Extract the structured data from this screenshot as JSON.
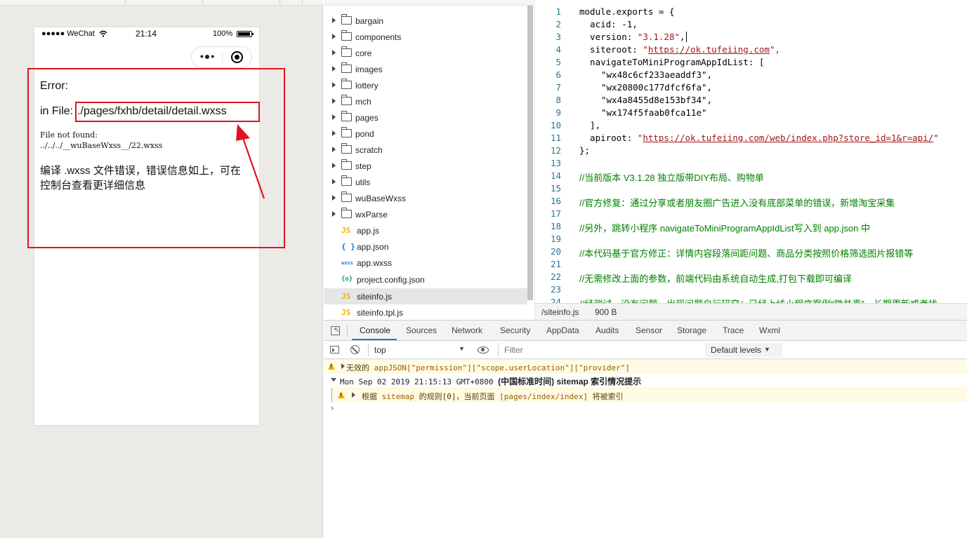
{
  "simulator": {
    "status": {
      "carrier": "●●●●● WeChat",
      "wifi_icon": "wifi-icon",
      "time": "21:14",
      "battery_pct": "100%"
    },
    "capsule": {
      "more_label": "•●•",
      "target_icon": "record-icon"
    },
    "error": {
      "title": "Error:",
      "file_label": "in File:",
      "file_path": "./pages/fxhb/detail/detail.wxss",
      "detail_line1": "File not found:",
      "detail_line2": "../../../__wuBaseWxss__/22.wxss",
      "note": "编译 .wxss 文件错误，错误信息如上，可在控制台查看更详细信息"
    },
    "annotation_color": "#e0141e"
  },
  "file_tree": {
    "folders": [
      "bargain",
      "components",
      "core",
      "images",
      "lottery",
      "mch",
      "pages",
      "pond",
      "scratch",
      "step",
      "utils",
      "wuBaseWxss",
      "wxParse"
    ],
    "files": [
      {
        "icon_label": "JS",
        "icon_name": "js-file-icon",
        "color": "#f0b400",
        "name": "app.js"
      },
      {
        "icon_label": "{ }",
        "icon_name": "json-file-icon",
        "color": "#1a73e8",
        "name": "app.json"
      },
      {
        "icon_label": "wxss",
        "icon_name": "wxss-file-icon",
        "color": "#1a73e8",
        "name": "app.wxss"
      },
      {
        "icon_label": "{o}",
        "icon_name": "config-file-icon",
        "color": "#18a058",
        "name": "project.config.json"
      },
      {
        "icon_label": "JS",
        "icon_name": "js-file-icon",
        "color": "#f0b400",
        "name": "siteinfo.js"
      },
      {
        "icon_label": "JS",
        "icon_name": "js-file-icon",
        "color": "#f0b400",
        "name": "siteinfo.tpl.js"
      }
    ],
    "selected": "siteinfo.js"
  },
  "editor": {
    "line_numbers": [
      "1",
      "2",
      "3",
      "4",
      "5",
      "6",
      "7",
      "8",
      "9",
      "10",
      "11",
      "12",
      "13",
      "14",
      "15",
      "16",
      "17",
      "18",
      "19",
      "20",
      "21",
      "22",
      "23",
      "24"
    ],
    "code": {
      "l1": "module.exports = {",
      "l2": "  acid: -1,",
      "l3_key": "  version: ",
      "l3_val": "\"3.1.28\"",
      "l3_end": ",",
      "l4_key": "  siteroot: ",
      "l4_q1": "\"",
      "l4_url": "https://ok.tufeiing.com",
      "l4_q2": "\",",
      "l5": "  navigateToMiniProgramAppIdList: [",
      "l6": "\"wx48c6cf233aeaddf3\",",
      "l7": "\"wx20800c177dfcf6fa\",",
      "l8": "\"wx4a8455d8e153bf34\",",
      "l9": "\"wx174f5faab0fca11e\"",
      "l10": "  ],",
      "l11_key": "  apiroot: ",
      "l11_q1": "\"",
      "l11_url": "https://ok.tufeiing.com/web/index.php?store_id=1&r=api/",
      "l11_q2": "\"",
      "l12": "};",
      "l14": "//当前版本 V3.1.28 独立版带DIY布局、购物单",
      "l16": "//官方修复：通过分享或者朋友圈广告进入没有底部菜单的错误，新增淘宝采集",
      "l18": "//另外，跳转小程序 navigateToMiniProgramAppIdList写入到 app.json 中",
      "l20": "//本代码基于官方修正：详情内容段落间距问题、商品分类按照价格筛选图片报错等",
      "l22": "//无需修改上面的参数，前端代码由系统自动生成,打包下载即可编译",
      "l24": "//经测试，没有问题，出现问题自行研究；已经上线小程序案例“微井喜”，长期更新或者找"
    },
    "status_path": "/siteinfo.js",
    "status_size": "900 B"
  },
  "devtools": {
    "tabs": [
      "Console",
      "Sources",
      "Network",
      "Security",
      "AppData",
      "Audits",
      "Sensor",
      "Storage",
      "Trace",
      "Wxml"
    ],
    "active_tab": "Console",
    "context": "top",
    "filter_placeholder": "Filter",
    "levels": "Default levels",
    "messages": {
      "m1_prefix": "无效的 ",
      "m1_key": "appJSON[\"permission\"][\"scope.userLocation\"][\"provider\"]",
      "m2_time": "Mon Sep 02 2019 21:15:13 GMT+0800 ",
      "m2_bold": "(中国标准时间) sitemap 索引情况提示",
      "m3_a": "根据 ",
      "m3_b": "sitemap",
      "m3_c": " 的规则[0]，当前页面 ",
      "m3_d": "[pages/index/index]",
      "m3_e": " 将被索引"
    },
    "prompt": "›",
    "accent_color": "#1a73e8",
    "warning_color": "#f2b600"
  }
}
